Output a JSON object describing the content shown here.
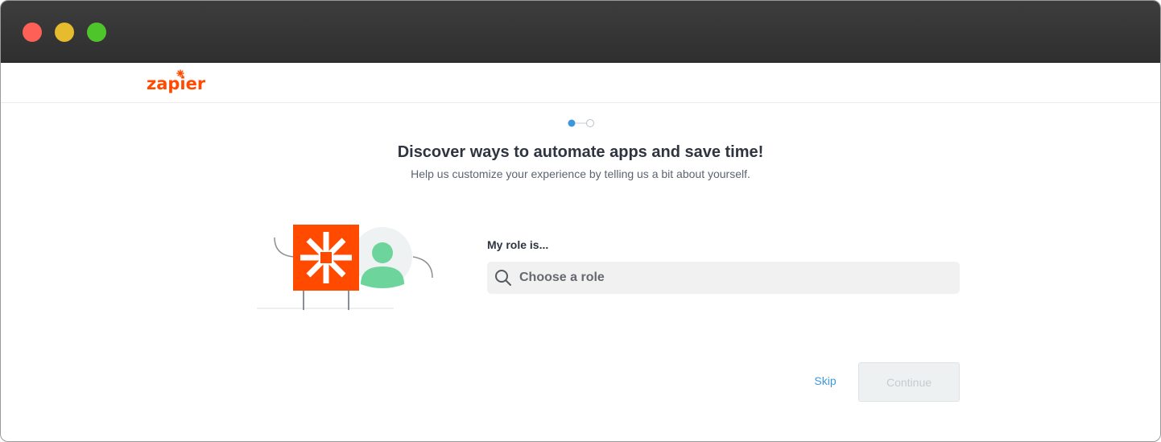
{
  "window": {
    "traffic_lights": [
      "close",
      "minimize",
      "maximize"
    ]
  },
  "header": {
    "logo_text": "zapier",
    "logo_color": "#ff4a00"
  },
  "progress": {
    "current_step": 1,
    "total_steps": 2,
    "active_color": "#3d97db"
  },
  "main": {
    "title": "Discover ways to automate apps and save time!",
    "subtitle": "Help us customize your experience by telling us a bit about yourself."
  },
  "role": {
    "label": "My role is...",
    "placeholder": "Choose a role",
    "value": "",
    "icon": "search-icon"
  },
  "actions": {
    "skip_label": "Skip",
    "continue_label": "Continue",
    "continue_enabled": false
  }
}
